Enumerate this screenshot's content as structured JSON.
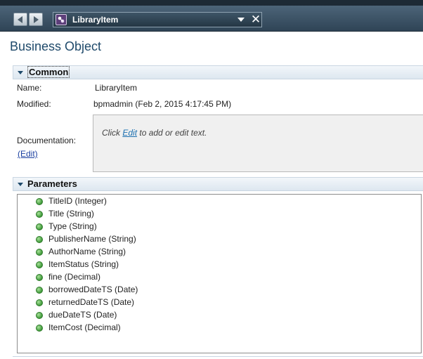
{
  "toolbar": {
    "selected_object": "LibraryItem",
    "back_icon": "left-arrow-icon",
    "forward_icon": "right-arrow-icon",
    "object_icon": "business-object-icon",
    "dropdown_icon": "chevron-down-icon",
    "close_icon": "close-icon",
    "close_glyph": "✕"
  },
  "page": {
    "title": "Business Object"
  },
  "common": {
    "section_title": "Common",
    "name_label": "Name:",
    "name_value": "LibraryItem",
    "modified_label": "Modified:",
    "modified_value": "bpmadmin (Feb 2, 2015 4:17:45 PM)",
    "documentation_label": "Documentation:",
    "documentation_edit_link": "(Edit)",
    "documentation_placeholder_before": "Click ",
    "documentation_placeholder_link": "Edit",
    "documentation_placeholder_after": " to add or edit text."
  },
  "parameters": {
    "section_title": "Parameters",
    "status_color": "#3f9a3a",
    "items": [
      "TitleID (Integer)",
      "Title (String)",
      "Type (String)",
      "PublisherName (String)",
      "AuthorName (String)",
      "ItemStatus (String)",
      "fine (Decimal)",
      "borrowedDateTS (Date)",
      "returnedDateTS (Date)",
      "dueDateTS (Date)",
      "ItemCost (Decimal)"
    ]
  },
  "colors": {
    "title": "#1f4a6b",
    "toolbar": "#3e5567",
    "link": "#1a3fa0"
  }
}
